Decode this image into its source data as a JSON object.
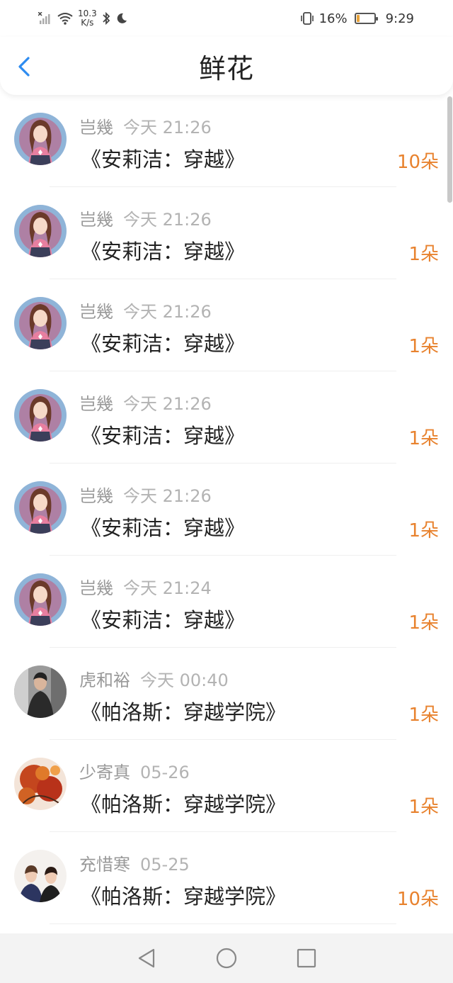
{
  "status_bar": {
    "network_speed_value": "10.3",
    "network_speed_unit": "K/s",
    "battery_percent": "16%",
    "battery_level": 0.16,
    "time": "9:29"
  },
  "header": {
    "title": "鲜花"
  },
  "items": [
    {
      "username": "岂幾",
      "time": "今天 21:26",
      "book": "《安莉洁：穿越》",
      "count": "10朵",
      "avatar": "anime-girl-avatar"
    },
    {
      "username": "岂幾",
      "time": "今天 21:26",
      "book": "《安莉洁：穿越》",
      "count": "1朵",
      "avatar": "anime-girl-avatar"
    },
    {
      "username": "岂幾",
      "time": "今天 21:26",
      "book": "《安莉洁：穿越》",
      "count": "1朵",
      "avatar": "anime-girl-avatar"
    },
    {
      "username": "岂幾",
      "time": "今天 21:26",
      "book": "《安莉洁：穿越》",
      "count": "1朵",
      "avatar": "anime-girl-avatar"
    },
    {
      "username": "岂幾",
      "time": "今天 21:26",
      "book": "《安莉洁：穿越》",
      "count": "1朵",
      "avatar": "anime-girl-avatar"
    },
    {
      "username": "岂幾",
      "time": "今天 21:24",
      "book": "《安莉洁：穿越》",
      "count": "1朵",
      "avatar": "anime-girl-avatar"
    },
    {
      "username": "虎和裕",
      "time": "今天 00:40",
      "book": "《帕洛斯：穿越学院》",
      "count": "1朵",
      "avatar": "man-photo-avatar"
    },
    {
      "username": "少寄真",
      "time": "05-26",
      "book": "《帕洛斯：穿越学院》",
      "count": "1朵",
      "avatar": "autumn-leaves-avatar"
    },
    {
      "username": "充惜寒",
      "time": "05-25",
      "book": "《帕洛斯：穿越学院》",
      "count": "10朵",
      "avatar": "couple-photo-avatar"
    }
  ],
  "colors": {
    "accent_blue": "#2e8cf0",
    "count_orange": "#e8822e",
    "meta_gray": "#9a9a9a"
  }
}
